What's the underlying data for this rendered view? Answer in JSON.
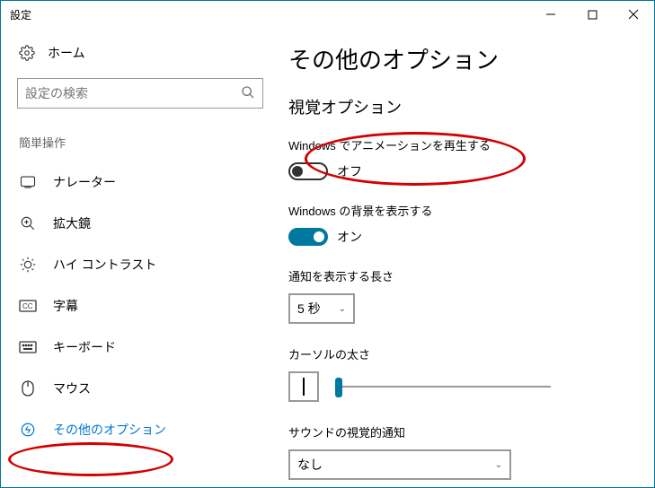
{
  "window": {
    "title": "設定"
  },
  "sidebar": {
    "home": "ホーム",
    "search_placeholder": "設定の検索",
    "group": "簡単操作",
    "items": [
      {
        "label": "ナレーター"
      },
      {
        "label": "拡大鏡"
      },
      {
        "label": "ハイ コントラスト"
      },
      {
        "label": "字幕"
      },
      {
        "label": "キーボード"
      },
      {
        "label": "マウス"
      },
      {
        "label": "その他のオプション"
      }
    ]
  },
  "main": {
    "page_title": "その他のオプション",
    "section_title": "視覚オプション",
    "anim": {
      "label": "Windows でアニメーションを再生する",
      "state": "オフ"
    },
    "bg": {
      "label": "Windows の背景を表示する",
      "state": "オン"
    },
    "notif_duration": {
      "label": "通知を表示する長さ",
      "value": "5 秒"
    },
    "cursor": {
      "label": "カーソルの太さ"
    },
    "sound_visual": {
      "label": "サウンドの視覚的通知",
      "value": "なし"
    }
  }
}
